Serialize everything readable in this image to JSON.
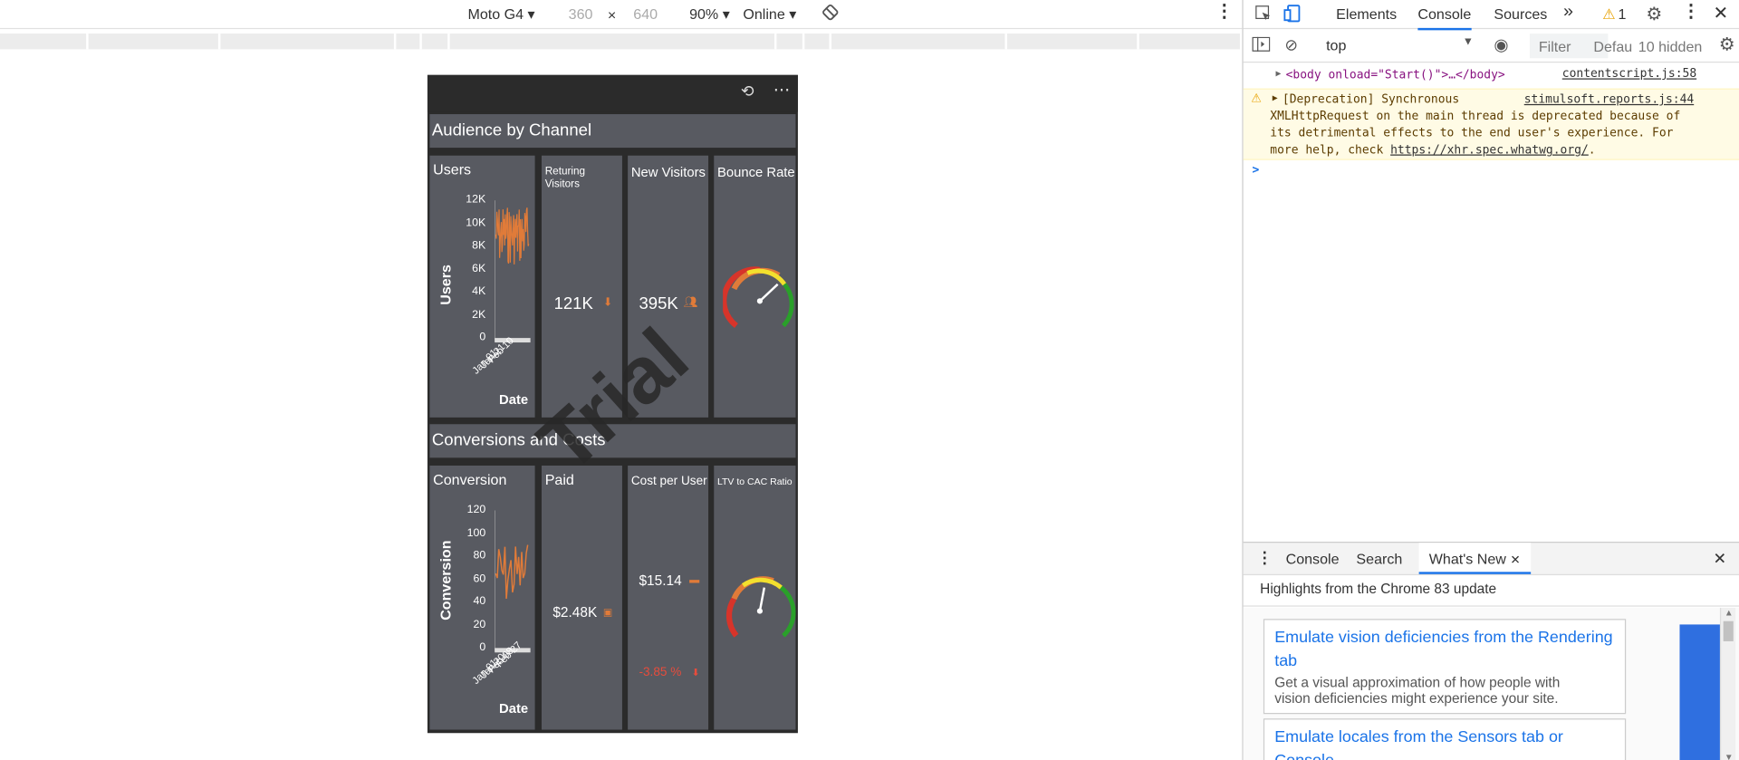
{
  "emulator": {
    "device": "Moto G4",
    "width": "360",
    "x_sep": "×",
    "height": "640",
    "zoom": "90%",
    "network": "Online"
  },
  "dashboard": {
    "section1": "Audience by Channel",
    "section2": "Conversions and Costs",
    "users_title": "Users",
    "users_axis": "Users",
    "users_xlabel": "Date",
    "users_ticks": [
      "12K",
      "10K",
      "8K",
      "6K",
      "4K",
      "2K",
      "0"
    ],
    "users_dates": [
      "Jan 01",
      "Jan 21",
      "Feb 10"
    ],
    "returning_title": "Returing Visitors",
    "returning_value": "121K",
    "new_title": "New Visitors",
    "new_value": "395K",
    "bounce_title": "Bounce Rate",
    "conversion_title": "Conversion",
    "conversion_axis": "Conversion",
    "conversion_xlabel": "Date",
    "conversion_ticks": [
      "120",
      "100",
      "80",
      "60",
      "40",
      "20",
      "0"
    ],
    "conversion_dates": [
      "Jan 01",
      "Jan 20",
      "Feb 08",
      "Feb 27"
    ],
    "paid_title": "Paid",
    "paid_value": "$2.48K",
    "cpu_title": "Cost per User",
    "cpu_value": "$15.14",
    "cpu_change": "-3.85 %",
    "ltv_title": "LTV to CAC Ratio",
    "watermark": "Trial",
    "accent": "#e07b39",
    "bg": "#585a61"
  },
  "devtools": {
    "tabs": [
      "Elements",
      "Console",
      "Sources"
    ],
    "active_tab": "Console",
    "warn_count": "1",
    "context": "top",
    "filter_placeholder": "Filter",
    "levels": "Defau",
    "hidden": "10 hidden",
    "log1_text": "<body onload=\"Start()\">…</body>",
    "log1_src": "contentscript.js:58",
    "log2_head": "[Deprecation] Synchronous",
    "log2_src": "stimulsoft.reports.js:44",
    "log2_l2": "XMLHttpRequest on the main thread is deprecated because of",
    "log2_l3": "its detrimental effects to the end user's experience. For",
    "log2_l4": "more help, check",
    "log2_link": "https://xhr.spec.whatwg.org/",
    "log2_end": ".",
    "prompt": ">"
  },
  "drawer": {
    "tabs": [
      "Console",
      "Search",
      "What's New"
    ],
    "active": "What's New",
    "highlights": "Highlights from the Chrome 83 update",
    "card1_title_a": "Emulate vision deficiencies from the Rendering",
    "card1_title_b": "tab",
    "card1_desc_a": "Get a visual approximation of how people with",
    "card1_desc_b": "vision deficiencies might experience your site.",
    "card2_title_a": "Emulate locales from the Sensors tab or",
    "card2_title_b": "Console"
  }
}
